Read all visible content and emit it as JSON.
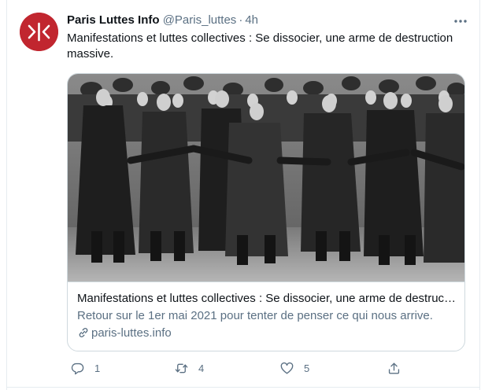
{
  "tweet": {
    "display_name": "Paris Luttes Info",
    "handle": "@Paris_luttes",
    "separator": "·",
    "time": "4h",
    "more_icon": "more-horizontal-icon",
    "text": "Manifestations et luttes collectives : Se dissocier, une arme de destruction massive.",
    "avatar": {
      "logo_text": ">|<",
      "color": "#c1262f"
    }
  },
  "card": {
    "image_icon": "photo-crowd-march",
    "title": "Manifestations et luttes collectives : Se dissocier, une arme de destruc…",
    "description": "Retour sur le 1er mai 2021 pour tenter de penser ce qui nous arrive.",
    "domain": "paris-luttes.info"
  },
  "actions": {
    "reply_count": "1",
    "retweet_count": "4",
    "like_count": "5"
  },
  "colors": {
    "text_primary": "#0f1419",
    "text_secondary": "#5b7083",
    "border": "#cfd9de",
    "brand": "#c1262f"
  }
}
